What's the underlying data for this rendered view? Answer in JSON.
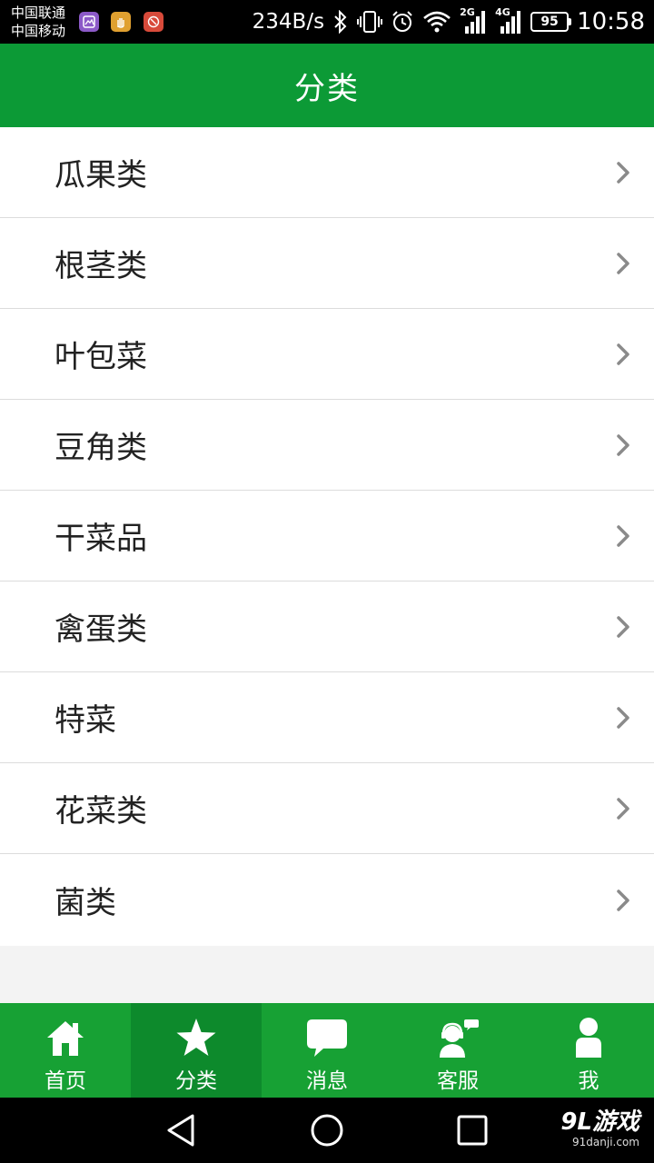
{
  "status_bar": {
    "carrier_1": "中国联通",
    "carrier_2": "中国移动",
    "net_speed": "234B/s",
    "net_type_1": "2G",
    "net_type_2": "4G",
    "battery": "95",
    "time": "10:58",
    "icons": [
      "bluetooth-icon",
      "vibrate-icon",
      "alarm-icon",
      "wifi-icon",
      "signal-icon",
      "battery-icon"
    ]
  },
  "header": {
    "title": "分类"
  },
  "categories": [
    {
      "label": "瓜果类"
    },
    {
      "label": "根茎类"
    },
    {
      "label": "叶包菜"
    },
    {
      "label": "豆角类"
    },
    {
      "label": "干菜品"
    },
    {
      "label": "禽蛋类"
    },
    {
      "label": "特菜"
    },
    {
      "label": "花菜类"
    },
    {
      "label": "菌类"
    }
  ],
  "bottom_nav": {
    "active": "分类",
    "tabs": [
      {
        "label": "首页",
        "icon": "home-icon"
      },
      {
        "label": "分类",
        "icon": "star-icon"
      },
      {
        "label": "消息",
        "icon": "message-icon"
      },
      {
        "label": "客服",
        "icon": "customer-service-icon"
      },
      {
        "label": "我",
        "icon": "user-icon"
      }
    ]
  },
  "watermark": {
    "logo": "9L游戏",
    "url": "91danji.com"
  },
  "colors": {
    "header_green": "#0c9a36",
    "nav_green": "#17a134",
    "nav_active": "#0d8a2c"
  }
}
